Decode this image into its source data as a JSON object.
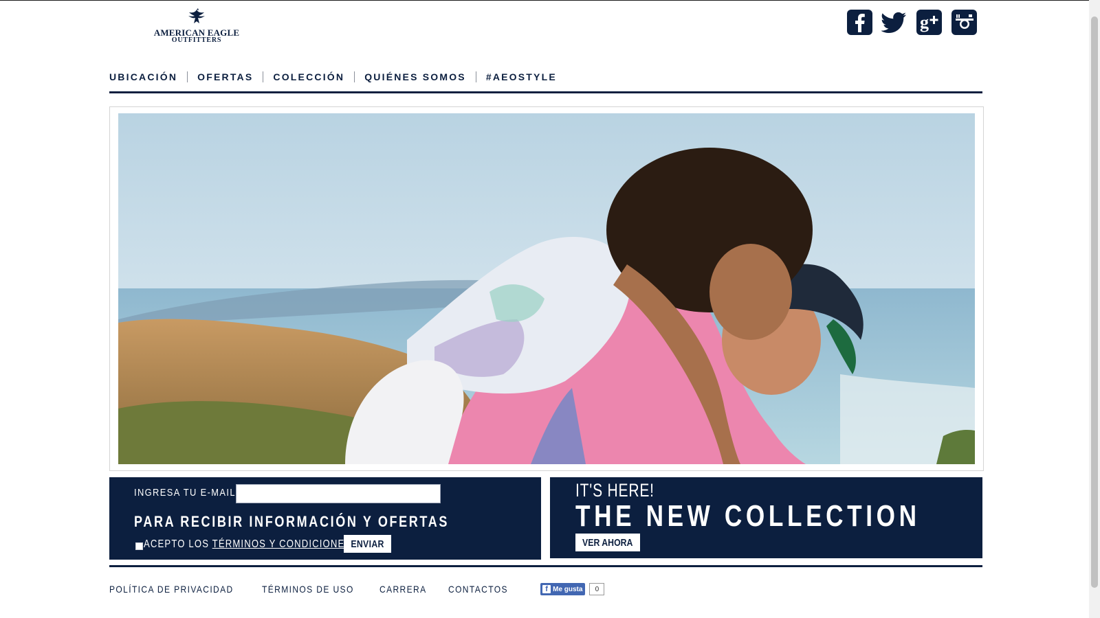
{
  "brand": {
    "line1": "AMERICAN EAGLE",
    "line2": "OUTFITTERS"
  },
  "social": [
    {
      "name": "facebook",
      "icon": "facebook-icon"
    },
    {
      "name": "twitter",
      "icon": "twitter-icon"
    },
    {
      "name": "google-plus",
      "icon": "google-plus-icon"
    },
    {
      "name": "instagram",
      "icon": "instagram-icon"
    }
  ],
  "nav": {
    "items": [
      {
        "label": "UBICACIÓN"
      },
      {
        "label": "OFERTAS"
      },
      {
        "label": "COLECCIÓN"
      },
      {
        "label": "QUIÉNES SOMOS"
      },
      {
        "label": "#AEOSTYLE"
      }
    ]
  },
  "signup": {
    "email_label": "INGRESA TU E-MAIL",
    "email_value": "",
    "heading": "PARA RECIBIR INFORMACIÓN Y OFERTAS",
    "accept_prefix": "ACEPTO LOS ",
    "accept_link": "TÉRMINOS Y CONDICIONES",
    "accept_suffix": ".",
    "submit": "ENVIAR"
  },
  "promo": {
    "kicker": "IT'S HERE!",
    "headline": "THE NEW COLLECTION",
    "cta": "VER AHORA"
  },
  "footer": {
    "links": [
      {
        "label": "POLÍTICA DE PRIVACIDAD"
      },
      {
        "label": "TÉRMINOS DE USO"
      },
      {
        "label": "CARRERA"
      },
      {
        "label": "CONTACTOS"
      }
    ],
    "like_label": "Me gusta",
    "like_count": "0"
  },
  "colors": {
    "navy": "#0c1f3f",
    "white": "#ffffff",
    "facebook_blue": "#4267b2"
  }
}
